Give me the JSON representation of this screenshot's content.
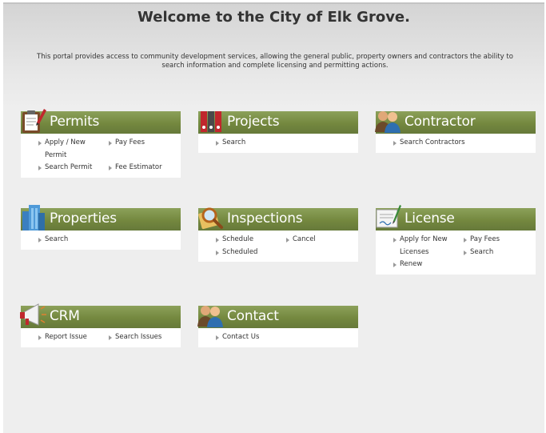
{
  "page": {
    "title": "Welcome to the City of Elk Grove.",
    "intro": "This portal provides access to community development services, allowing the general public, property owners and contractors the ability to search information and complete licensing and permitting actions."
  },
  "tiles": {
    "permits": {
      "title": "Permits",
      "icon": "permit-clipboard-icon",
      "links": [
        "Apply / New Permit",
        "Pay Fees",
        "Search Permit",
        "Fee Estimator"
      ]
    },
    "projects": {
      "title": "Projects",
      "icon": "binders-icon",
      "links": [
        "Search"
      ]
    },
    "contractor": {
      "title": "Contractor",
      "icon": "people-icon",
      "links": [
        "Search Contractors"
      ]
    },
    "properties": {
      "title": "Properties",
      "icon": "building-icon",
      "links": [
        "Search"
      ]
    },
    "inspections": {
      "title": "Inspections",
      "icon": "magnifier-icon",
      "links": [
        "Schedule",
        "Cancel",
        "Scheduled"
      ]
    },
    "license": {
      "title": "License",
      "icon": "certificate-icon",
      "links": [
        "Apply for New",
        "Pay Fees",
        "Licenses",
        "Search",
        "Renew"
      ]
    },
    "crm": {
      "title": "CRM",
      "icon": "megaphone-icon",
      "links": [
        "Report Issue",
        "Search Issues"
      ]
    },
    "contact": {
      "title": "Contact",
      "icon": "people-icon",
      "links": [
        "Contact Us"
      ]
    }
  },
  "colors": {
    "header_green": "#74883f",
    "background": "#eeeeee",
    "text": "#333333"
  }
}
